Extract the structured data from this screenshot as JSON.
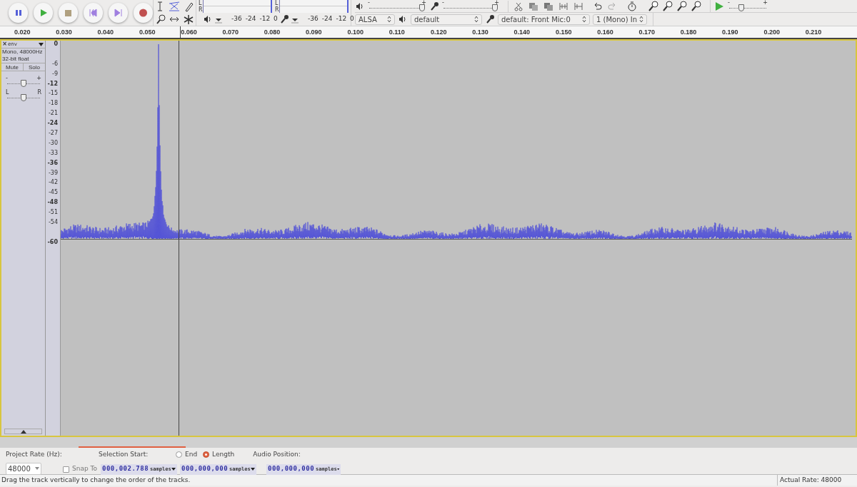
{
  "meters": [
    {
      "kind": "playback",
      "channels": [
        "L",
        "R"
      ],
      "ticks": [
        "-36",
        "-24",
        "-12",
        "0"
      ]
    },
    {
      "kind": "record",
      "channels": [
        "L",
        "R"
      ],
      "ticks": [
        "-36",
        "-24",
        "-12",
        "0"
      ]
    }
  ],
  "mixer": [
    {
      "kind": "playback",
      "minus": "-",
      "plus": "+",
      "level": 1.0
    },
    {
      "kind": "record",
      "minus": "-",
      "plus": "+",
      "level": 1.0
    }
  ],
  "play_at_speed": {
    "minus": "-",
    "plus": "+",
    "level": 0.3
  },
  "device_toolbar": {
    "host": "ALSA",
    "output": "default",
    "input": "default: Front Mic:0",
    "channels": "1 (Mono) In"
  },
  "ruler": [
    "0.020",
    "0.030",
    "0.040",
    "0.050",
    "0.060",
    "0.070",
    "0.080",
    "0.090",
    "0.100",
    "0.110",
    "0.120",
    "0.130",
    "0.140",
    "0.150",
    "0.160",
    "0.170",
    "0.180",
    "0.190",
    "0.200",
    "0.210"
  ],
  "track": {
    "close": "×",
    "name": "env",
    "format": "Mono, 48000Hz",
    "sample_format": "32-bit float",
    "mute": "Mute",
    "solo": "Solo",
    "gain": {
      "minus": "-",
      "plus": "+",
      "level": 0.5
    },
    "pan": {
      "left": "L",
      "right": "R",
      "level": 0.5
    }
  },
  "scale": [
    {
      "label": "0",
      "major": true
    },
    {
      "label": "-6",
      "major": false
    },
    {
      "label": "-9",
      "major": false
    },
    {
      "label": "-12",
      "major": true
    },
    {
      "label": "-15",
      "major": false
    },
    {
      "label": "-18",
      "major": false
    },
    {
      "label": "-21",
      "major": false
    },
    {
      "label": "-24",
      "major": true
    },
    {
      "label": "-27",
      "major": false
    },
    {
      "label": "-30",
      "major": false
    },
    {
      "label": "-33",
      "major": false
    },
    {
      "label": "-36",
      "major": true
    },
    {
      "label": "-39",
      "major": false
    },
    {
      "label": "-42",
      "major": false
    },
    {
      "label": "-45",
      "major": false
    },
    {
      "label": "-48",
      "major": true
    },
    {
      "label": "-51",
      "major": false
    },
    {
      "label": "-54",
      "major": false
    },
    {
      "label": "-60",
      "major": true
    }
  ],
  "selection_toolbar": {
    "project_rate_label": "Project Rate (Hz):",
    "project_rate": "48000",
    "snap_to": {
      "label": "Snap To",
      "checked": false
    },
    "selection_start_label": "Selection Start:",
    "modes": [
      {
        "label": "End",
        "selected": false
      },
      {
        "label": "Length",
        "selected": true
      }
    ],
    "audio_position_label": "Audio Position:",
    "fields": [
      {
        "value": "000,002.788",
        "unit": "samples"
      },
      {
        "value": "000,000,000",
        "unit": "samples"
      },
      {
        "value": "000,000,000",
        "unit": "samples"
      }
    ]
  },
  "status_bar": {
    "message": "Drag the track vertically to change the order of the tracks.",
    "rate": "Actual Rate: 48000"
  }
}
